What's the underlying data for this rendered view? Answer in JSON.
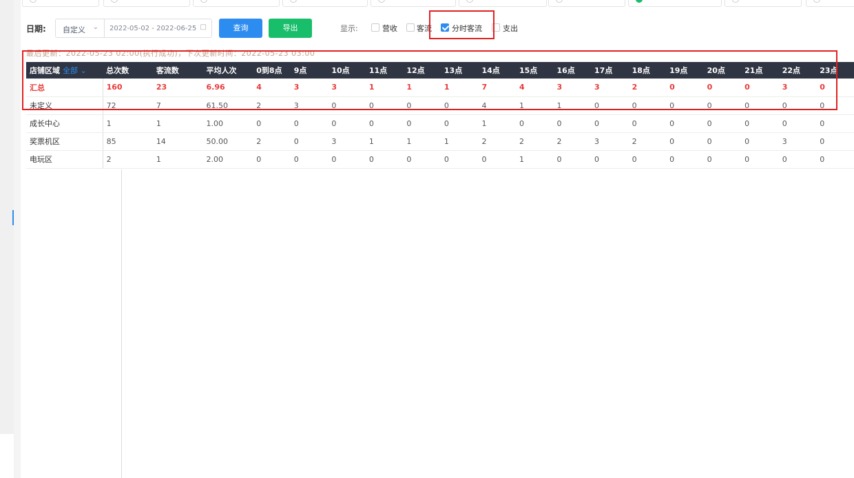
{
  "filter": {
    "date_label": "日期:",
    "range_type": "自定义",
    "date_range": "2022-05-02 - 2022-06-25",
    "query_label": "查询",
    "export_label": "导出",
    "display_label": "显示:",
    "options": [
      {
        "label": "营收",
        "checked": false
      },
      {
        "label": "客流",
        "checked": false
      },
      {
        "label": "分时客流",
        "checked": true
      },
      {
        "label": "支出",
        "checked": false
      }
    ]
  },
  "update_text": "最后更新：2022-05-23 02:00(执行成功)，下次更新时间：2022-05-23 03:00",
  "table": {
    "area_header": "店铺区域",
    "area_filter": "全部",
    "columns": [
      "总次数",
      "客流数",
      "平均人次",
      "0到8点",
      "9点",
      "10点",
      "11点",
      "12点",
      "13点",
      "14点",
      "15点",
      "16点",
      "17点",
      "18点",
      "19点",
      "20点",
      "21点",
      "22点",
      "23点"
    ],
    "rows": [
      {
        "name": "汇总",
        "values": [
          "160",
          "23",
          "6.96",
          "4",
          "3",
          "3",
          "1",
          "1",
          "1",
          "7",
          "4",
          "3",
          "3",
          "2",
          "0",
          "0",
          "0",
          "3",
          "0"
        ]
      },
      {
        "name": "未定义",
        "values": [
          "72",
          "7",
          "61.50",
          "2",
          "3",
          "0",
          "0",
          "0",
          "0",
          "4",
          "1",
          "1",
          "0",
          "0",
          "0",
          "0",
          "0",
          "0",
          "0"
        ]
      },
      {
        "name": "成长中心",
        "values": [
          "1",
          "1",
          "1.00",
          "0",
          "0",
          "0",
          "0",
          "0",
          "0",
          "1",
          "0",
          "0",
          "0",
          "0",
          "0",
          "0",
          "0",
          "0",
          "0"
        ]
      },
      {
        "name": "奖票机区",
        "values": [
          "85",
          "14",
          "50.00",
          "2",
          "0",
          "3",
          "1",
          "1",
          "1",
          "2",
          "2",
          "2",
          "3",
          "2",
          "0",
          "0",
          "0",
          "3",
          "0"
        ]
      },
      {
        "name": "电玩区",
        "values": [
          "2",
          "1",
          "2.00",
          "0",
          "0",
          "0",
          "0",
          "0",
          "0",
          "0",
          "1",
          "0",
          "0",
          "0",
          "0",
          "0",
          "0",
          "0",
          "0"
        ]
      }
    ]
  },
  "colors": {
    "accent": "#2d8cf0",
    "export": "#19be6b",
    "header": "#2f3542",
    "total": "#e83a3a",
    "highlight": "#e02020"
  }
}
